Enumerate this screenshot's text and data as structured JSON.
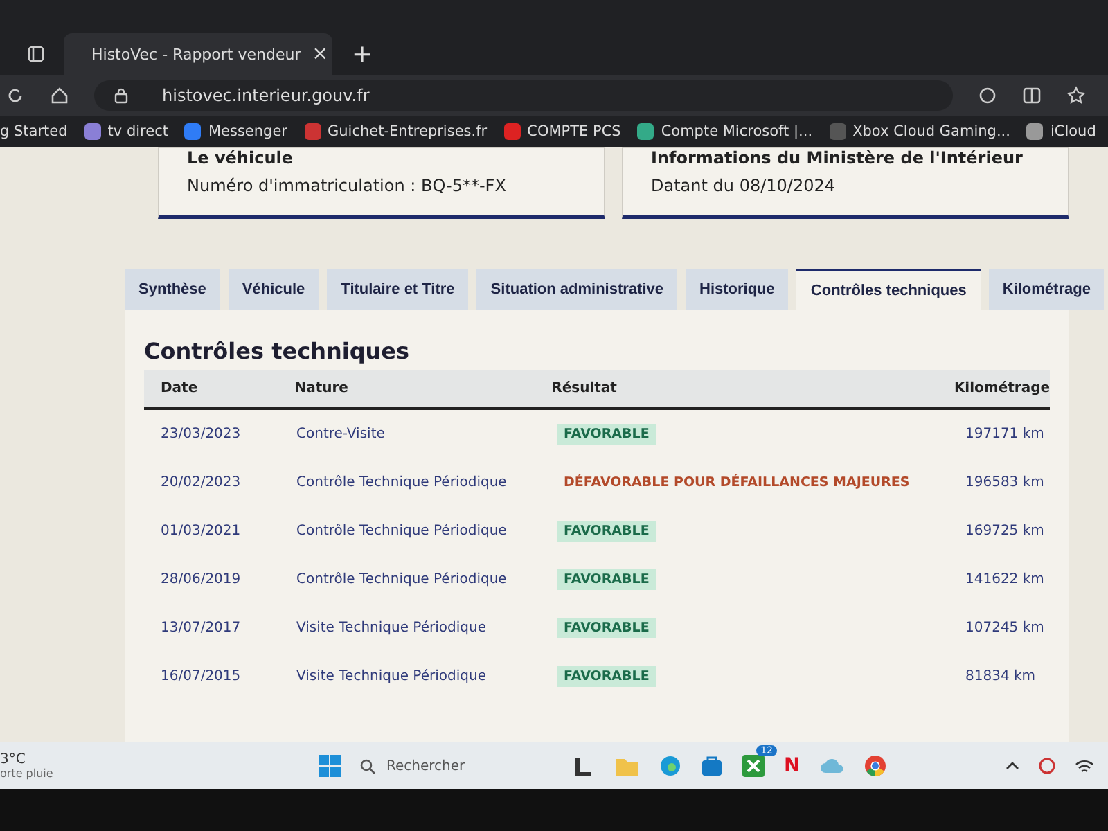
{
  "browser": {
    "tab_title": "HistoVec - Rapport vendeur",
    "tab_close": "×",
    "new_tab": "+",
    "url": "histovec.interieur.gouv.fr"
  },
  "bookmarks": [
    {
      "label": "g Started",
      "kind": "plain"
    },
    {
      "label": "tv direct",
      "kind": "tv"
    },
    {
      "label": "Messenger",
      "kind": "messenger"
    },
    {
      "label": "Guichet-Entreprises.fr",
      "kind": "guichet"
    },
    {
      "label": "COMPTE PCS",
      "kind": "pcs"
    },
    {
      "label": "Compte Microsoft |...",
      "kind": "microsoft"
    },
    {
      "label": "Xbox Cloud Gaming...",
      "kind": "xbox"
    },
    {
      "label": "iCloud",
      "kind": "apple"
    }
  ],
  "cards": [
    {
      "title": "Le véhicule",
      "text": "Numéro d'immatriculation : BQ-5**-FX"
    },
    {
      "title": "Informations du Ministère de l'Intérieur",
      "text": "Datant du 08/10/2024"
    }
  ],
  "tabs": [
    {
      "label": "Synthèse",
      "selected": false
    },
    {
      "label": "Véhicule",
      "selected": false
    },
    {
      "label": "Titulaire et Titre",
      "selected": false
    },
    {
      "label": "Situation administrative",
      "selected": false
    },
    {
      "label": "Historique",
      "selected": false
    },
    {
      "label": "Contrôles techniques",
      "selected": true
    },
    {
      "label": "Kilométrage",
      "selected": false
    }
  ],
  "section_title": "Contrôles techniques",
  "table": {
    "columns": [
      "Date",
      "Nature",
      "Résultat",
      "Kilométrage"
    ],
    "rows": [
      {
        "date": "23/03/2023",
        "nature": "Contre-Visite",
        "result": "FAVORABLE",
        "kind": "favorable",
        "km": "197171 km"
      },
      {
        "date": "20/02/2023",
        "nature": "Contrôle Technique Périodique",
        "result": "DÉFAVORABLE POUR DÉFAILLANCES MAJEURES",
        "kind": "unfavorable",
        "km": "196583 km"
      },
      {
        "date": "01/03/2021",
        "nature": "Contrôle Technique Périodique",
        "result": "FAVORABLE",
        "kind": "favorable",
        "km": "169725 km"
      },
      {
        "date": "28/06/2019",
        "nature": "Contrôle Technique Périodique",
        "result": "FAVORABLE",
        "kind": "favorable",
        "km": "141622 km"
      },
      {
        "date": "13/07/2017",
        "nature": "Visite Technique Périodique",
        "result": "FAVORABLE",
        "kind": "favorable",
        "km": "107245 km"
      },
      {
        "date": "16/07/2015",
        "nature": "Visite Technique Périodique",
        "result": "FAVORABLE",
        "kind": "favorable",
        "km": "81834 km"
      }
    ]
  },
  "taskbar": {
    "weather_temp": "3°C",
    "weather_text": "orte pluie",
    "search_placeholder": "Rechercher",
    "xbox_badge": "12",
    "netflix_glyph": "N"
  }
}
